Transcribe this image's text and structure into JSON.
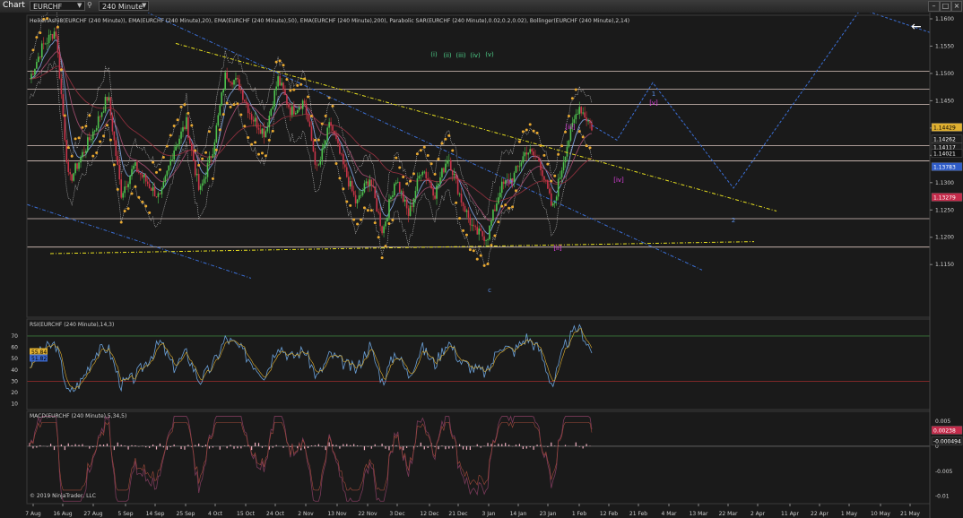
{
  "app": {
    "title": "Chart",
    "instrument": "EURCHF",
    "timeframe": "240 Minute",
    "back_arrow": "←",
    "icons": [
      "search-icon",
      "chevron-down-icon",
      "minimize-icon",
      "maximize-icon",
      "close-icon"
    ]
  },
  "chart_data": [
    {
      "type": "candlestick",
      "title": "HeikenAshi8(EURCHF (240 Minute)), EMA(EURCHF (240 Minute),20), EMA(EURCHF (240 Minute),50), EMA(EURCHF (240 Minute),200), Parabolic SAR(EURCHF (240 Minute),0.02,0.2,0.02), Bollinger(EURCHF (240 Minute),2,14)",
      "ylim": [
        1.145,
        1.162
      ],
      "y_ticks": [
        "1.1600",
        "1.1550",
        "1.1500",
        "1.1450",
        "1.1400",
        "1.1350",
        "1.1300",
        "1.1250",
        "1.1200",
        "1.1150"
      ],
      "y_tick_values": [
        1.16,
        1.155,
        1.15,
        1.145,
        1.14,
        1.135,
        1.13,
        1.125,
        1.12,
        1.115
      ],
      "x_ticks": [
        "7 Aug",
        "16 Aug",
        "27 Aug",
        "5 Sep",
        "14 Sep",
        "25 Sep",
        "4 Oct",
        "15 Oct",
        "24 Oct",
        "2 Nov",
        "13 Nov",
        "22 Nov",
        "3 Dec",
        "12 Dec",
        "21 Dec",
        "3 Jan",
        "14 Jan",
        "23 Jan",
        "1 Feb",
        "12 Feb",
        "21 Feb",
        "4 Mar",
        "13 Mar",
        "22 Mar",
        "2 Apr",
        "11 Apr",
        "22 Apr",
        "1 May",
        "10 May",
        "21 May"
      ],
      "price_labels": [
        {
          "text": "1.14429",
          "value": 1.14429,
          "color": "#e0b030"
        },
        {
          "text": "1.14262",
          "value": 1.14262,
          "color": "#1e1e1e"
        },
        {
          "text": "1.14117",
          "value": 1.14117,
          "color": "#1e1e1e"
        },
        {
          "text": "1.14021",
          "value": 1.14021,
          "color": "#101010"
        },
        {
          "text": "1.13783",
          "value": 1.13783,
          "color": "#2f5cc8"
        },
        {
          "text": "1.13279",
          "value": 1.13279,
          "color": "#c42a4a"
        }
      ],
      "horizontal_levels": [
        1.1504,
        1.1471,
        1.1443,
        1.1368,
        1.134,
        1.1234,
        1.1182
      ],
      "close_series_approx": [
        1.149,
        1.155,
        1.158,
        1.13,
        1.135,
        1.14,
        1.146,
        1.128,
        1.133,
        1.13,
        1.127,
        1.136,
        1.141,
        1.128,
        1.136,
        1.15,
        1.148,
        1.142,
        1.139,
        1.149,
        1.143,
        1.145,
        1.132,
        1.141,
        1.133,
        1.126,
        1.131,
        1.121,
        1.131,
        1.124,
        1.133,
        1.128,
        1.135,
        1.127,
        1.121,
        1.12,
        1.129,
        1.131,
        1.136,
        1.134,
        1.125,
        1.136,
        1.1442,
        1.1402
      ],
      "wave_labels": [
        {
          "text": "(i)",
          "color": "#4fd08a"
        },
        {
          "text": "(ii)",
          "color": "#4fd08a"
        },
        {
          "text": "(iii)",
          "color": "#4fd08a"
        },
        {
          "text": "(iv)",
          "color": "#4fd08a"
        },
        {
          "text": "(v)",
          "color": "#4fd08a"
        },
        {
          "text": "[i]",
          "color": "#e040e0"
        },
        {
          "text": "[ii]",
          "color": "#e040e0"
        },
        {
          "text": "[iii]",
          "color": "#e040e0"
        },
        {
          "text": "[iv]",
          "color": "#e040e0"
        },
        {
          "text": "[v]",
          "color": "#e040e0"
        },
        {
          "text": "c",
          "color": "#5b8fe6"
        },
        {
          "text": "2",
          "color": "#5b8fe6"
        },
        {
          "text": "1",
          "color": "#5b8fe6"
        }
      ]
    },
    {
      "type": "line",
      "title": "RSI(EURCHF (240 Minute),14,3)",
      "ylim": [
        5,
        85
      ],
      "y_ticks": [
        "70",
        "60",
        "50",
        "40",
        "30",
        "20",
        "10"
      ],
      "y_tick_values": [
        70,
        60,
        50,
        40,
        30,
        20,
        10
      ],
      "value_labels": [
        {
          "text": "55.84",
          "color": "#e0b030"
        },
        {
          "text": "51.82",
          "color": "#3a66c8"
        }
      ],
      "overbought": 70,
      "oversold": 30,
      "rsi_approx": [
        44,
        58,
        63,
        18,
        31,
        55,
        60,
        27,
        33,
        48,
        65,
        42,
        55,
        30,
        44,
        68,
        60,
        47,
        35,
        63,
        51,
        58,
        33,
        54,
        46,
        40,
        62,
        29,
        57,
        35,
        60,
        45,
        66,
        47,
        41,
        37,
        63,
        56,
        69,
        58,
        26,
        63,
        79,
        55.84
      ]
    },
    {
      "type": "line",
      "title": "MACD(EURCHF (240 Minute),5,34,5)",
      "ylim": [
        -0.0115,
        0.007
      ],
      "y_ticks": [
        "0.005",
        "0",
        "-0.005",
        "-0.01"
      ],
      "y_tick_values": [
        0.005,
        0,
        -0.005,
        -0.01
      ],
      "value_labels": [
        {
          "text": "0.00238",
          "color": "#c42a4a"
        },
        {
          "text": "-0.000494",
          "color": "#1e1e1e"
        }
      ]
    }
  ],
  "footer": {
    "copyright": "© 2019 NinjaTrader, LLC"
  }
}
